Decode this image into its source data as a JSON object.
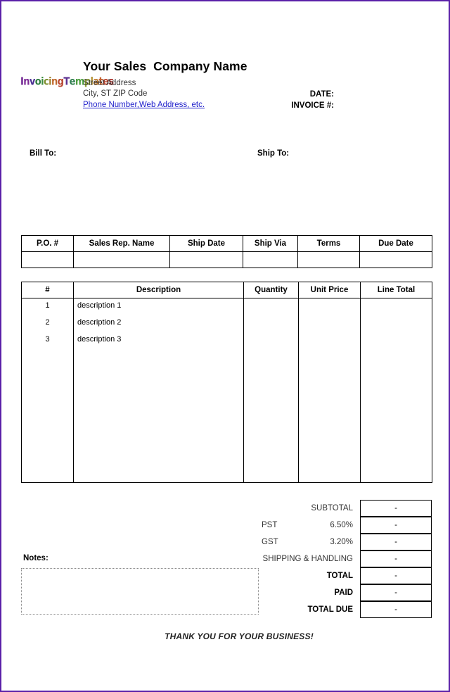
{
  "page": {
    "border_color": "#5b21a8",
    "background": "#ffffff"
  },
  "header": {
    "logo": {
      "name": "invoicing-templates-logo",
      "text": "InvoicingTemplates",
      "letters": [
        {
          "ch": "I",
          "color": "#6b1f8f"
        },
        {
          "ch": "n",
          "color": "#7d2b96"
        },
        {
          "ch": "v",
          "color": "#4b2f93"
        },
        {
          "ch": "o",
          "color": "#2f7d3f"
        },
        {
          "ch": "i",
          "color": "#3f8f3f"
        },
        {
          "ch": "c",
          "color": "#7f8f2f"
        },
        {
          "ch": "i",
          "color": "#9f7f2f"
        },
        {
          "ch": "n",
          "color": "#c06a2f"
        },
        {
          "ch": "g",
          "color": "#b8452f"
        },
        {
          "ch": "T",
          "color": "#5b2f8f"
        },
        {
          "ch": "e",
          "color": "#2f7f4f"
        },
        {
          "ch": "m",
          "color": "#4f9f3f"
        },
        {
          "ch": "p",
          "color": "#8f9f2f"
        },
        {
          "ch": "l",
          "color": "#b0902f"
        },
        {
          "ch": "a",
          "color": "#c07a2f"
        },
        {
          "ch": "t",
          "color": "#c4602f"
        },
        {
          "ch": "e",
          "color": "#b8452f"
        },
        {
          "ch": "s",
          "color": "#a8352f"
        }
      ]
    },
    "company_name": "Your Sales  Company Name",
    "address_line1": "Street Address",
    "address_line2": "City, ST  ZIP Code",
    "address_line3": "Phone Number,Web Address, etc.",
    "address_line3_color": "#2222cc",
    "date_label": "DATE:",
    "invoice_label": "INVOICE #:"
  },
  "parties": {
    "bill_to_label": "Bill To:",
    "ship_to_label": "Ship To:"
  },
  "info_table": {
    "headers": [
      "P.O. #",
      "Sales Rep. Name",
      "Ship Date",
      "Ship Via",
      "Terms",
      "Due Date"
    ],
    "row": [
      "",
      "",
      "",
      "",
      "",
      ""
    ]
  },
  "items_table": {
    "headers": [
      "#",
      "Description",
      "Quantity",
      "Unit Price",
      "Line Total"
    ],
    "rows": [
      {
        "num": "1",
        "description": "description 1",
        "quantity": "",
        "unit_price": "",
        "line_total": ""
      },
      {
        "num": "2",
        "description": "description 2",
        "quantity": "",
        "unit_price": "",
        "line_total": ""
      },
      {
        "num": "3",
        "description": "description 3",
        "quantity": "",
        "unit_price": "",
        "line_total": ""
      }
    ]
  },
  "totals": {
    "rows": [
      {
        "label": "SUBTOTAL",
        "taxname": "",
        "value": "-",
        "bold": false
      },
      {
        "label": "6.50%",
        "taxname": "PST",
        "value": "-",
        "bold": false
      },
      {
        "label": "3.20%",
        "taxname": "GST",
        "value": "-",
        "bold": false
      },
      {
        "label": "SHIPPING & HANDLING",
        "taxname": "",
        "value": "-",
        "bold": false
      },
      {
        "label": "TOTAL",
        "taxname": "",
        "value": "-",
        "bold": true
      },
      {
        "label": "PAID",
        "taxname": "",
        "value": "-",
        "bold": true
      },
      {
        "label": "TOTAL DUE",
        "taxname": "",
        "value": "-",
        "bold": true
      }
    ]
  },
  "notes": {
    "label": "Notes:",
    "value": ""
  },
  "footer": {
    "thank_you": "THANK YOU FOR YOUR BUSINESS!"
  }
}
